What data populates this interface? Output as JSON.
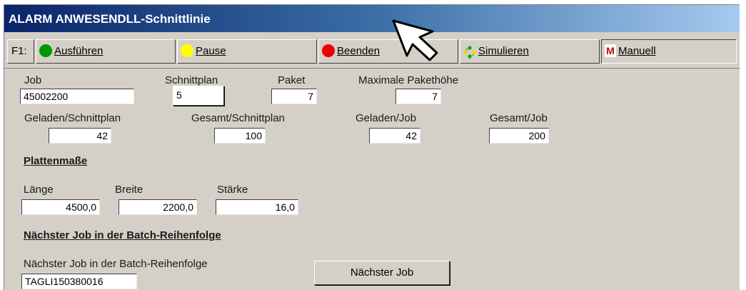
{
  "window": {
    "title": "ALARM ANWESENDLL-Schnittlinie"
  },
  "toolbar": {
    "f1_label": "F1:",
    "buttons": [
      {
        "label": "Ausführen",
        "icon": "green-circle-icon",
        "color": "#009900"
      },
      {
        "label": "Pause",
        "icon": "yellow-circle-icon",
        "color": "#ffff00"
      },
      {
        "label": "Beenden",
        "icon": "red-circle-icon",
        "color": "#ee0000"
      },
      {
        "label": "Simulieren",
        "icon": "simulate-icon",
        "color": "#00aa00"
      },
      {
        "label": "Manuell",
        "icon": "manual-m-icon",
        "color": "#cc0000",
        "icon_text": "M"
      }
    ]
  },
  "job_section": {
    "job_label": "Job",
    "job_value": "45002200",
    "schnittplan_label": "Schnittplan",
    "schnittplan_value": "5",
    "paket_label": "Paket",
    "paket_value": "7",
    "max_paket_label": "Maximale Pakethöhe",
    "max_paket_value": "7",
    "geladen_schnittplan_label": "Geladen/Schnittplan",
    "geladen_schnittplan_value": "42",
    "gesamt_schnittplan_label": "Gesamt/Schnittplan",
    "gesamt_schnittplan_value": "100",
    "geladen_job_label": "Geladen/Job",
    "geladen_job_value": "42",
    "gesamt_job_label": "Gesamt/Job",
    "gesamt_job_value": "200"
  },
  "plattenmasse": {
    "heading": "Plattenmaße",
    "laenge_label": "Länge",
    "laenge_value": "4500,0",
    "breite_label": "Breite",
    "breite_value": "2200,0",
    "staerke_label": "Stärke",
    "staerke_value": "16,0"
  },
  "batch": {
    "heading": "Nächster Job in der Batch-Reihenfolge",
    "field_label": "Nächster Job in der Batch-Reihenfolge",
    "field_value": "TAGLI150380016",
    "button_label": "Nächster Job"
  }
}
